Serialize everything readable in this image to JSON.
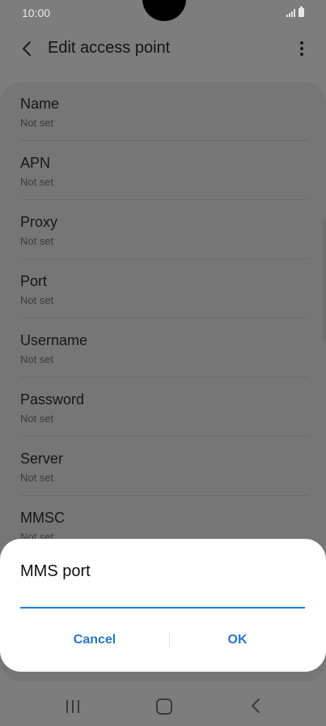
{
  "status_bar": {
    "time": "10:00"
  },
  "app_bar": {
    "title": "Edit access point"
  },
  "settings": {
    "items": [
      {
        "label": "Name",
        "value": "Not set"
      },
      {
        "label": "APN",
        "value": "Not set"
      },
      {
        "label": "Proxy",
        "value": "Not set"
      },
      {
        "label": "Port",
        "value": "Not set"
      },
      {
        "label": "Username",
        "value": "Not set"
      },
      {
        "label": "Password",
        "value": "Not set"
      },
      {
        "label": "Server",
        "value": "Not set"
      },
      {
        "label": "MMSC",
        "value": "Not set"
      }
    ]
  },
  "dialog": {
    "title": "MMS port",
    "input_value": "",
    "cancel_label": "Cancel",
    "ok_label": "OK"
  },
  "icons": {
    "back": "chevron-left-icon",
    "more": "more-vertical-icon",
    "nav_recent": "recent-apps-icon",
    "nav_home": "home-icon",
    "nav_back": "back-icon"
  },
  "colors": {
    "accent": "#2876c6",
    "input_underline": "#1f7ed6",
    "scrim_background": "#7d7d7d"
  }
}
